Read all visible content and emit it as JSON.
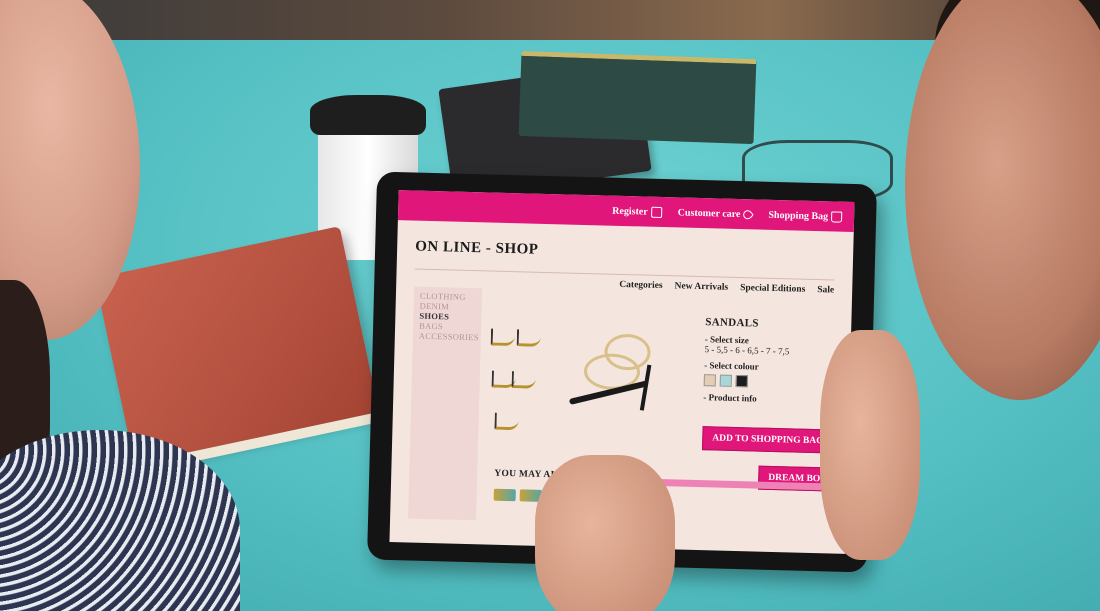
{
  "screen": {
    "topbar": {
      "register_label": "Register",
      "customer_care_label": "Customer care",
      "shopping_bag_label": "Shopping Bag",
      "icons": [
        "phone-icon",
        "heart-icon",
        "bag-icon"
      ]
    },
    "shop_title": "ON LINE - SHOP",
    "subnav": [
      "Categories",
      "New Arrivals",
      "Special Editions",
      "Sale"
    ],
    "sidebar": [
      "CLOTHING",
      "DENIM",
      "SHOES",
      "BAGS",
      "ACCESSORIES"
    ],
    "sidebar_active": "SHOES",
    "product": {
      "name": "SANDALS",
      "select_size_label": "- Select size",
      "sizes": "5 - 5,5 - 6 - 6,5 - 7 - 7,5",
      "select_colour_label": "- Select colour",
      "colours": [
        "#e3cdb4",
        "#a7d7d8",
        "#1d1d1d"
      ],
      "product_info_label": "- Product info"
    },
    "add_button_label": "ADD TO SHOPPING BAG",
    "dream_button_label": "DREAM BOX",
    "you_may_also_label": "YOU  MAY ALSO"
  },
  "colors": {
    "accent": "#e0167a",
    "table": "#56c3c6",
    "screen_bg": "#f4e6df"
  }
}
